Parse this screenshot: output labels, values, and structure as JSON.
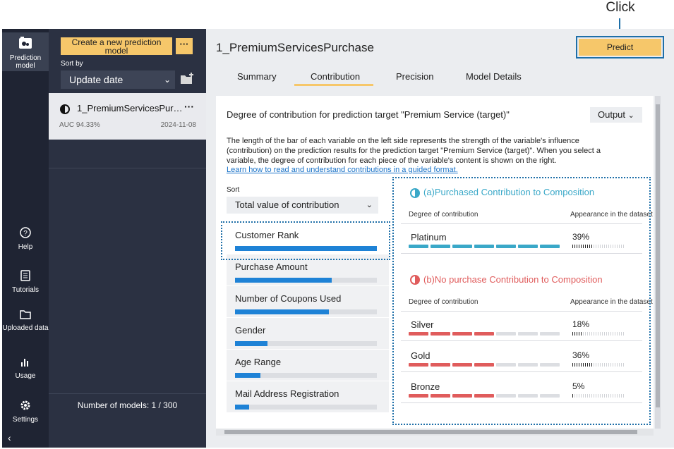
{
  "annotation": {
    "label": "Click"
  },
  "nav": {
    "items": [
      {
        "label": "Prediction model",
        "icon": "prediction-model-icon"
      },
      {
        "label": "Help",
        "icon": "help-icon"
      },
      {
        "label": "Tutorials",
        "icon": "tutorials-icon"
      },
      {
        "label": "Uploaded data",
        "icon": "folder-icon"
      },
      {
        "label": "Usage",
        "icon": "bar-chart-icon"
      },
      {
        "label": "Settings",
        "icon": "gear-icon"
      }
    ],
    "collapse": "‹"
  },
  "panel": {
    "create_label": "Create a new prediction model",
    "more_label": "···",
    "sort_by_label": "Sort by",
    "sort_value": "Update date",
    "models": [
      {
        "name": "1_PremiumServicesPurchase",
        "auc": "AUC 94.33%",
        "date": "2024-11-08"
      }
    ],
    "count_label": "Number of models: 1 / 300"
  },
  "main": {
    "title": "1_PremiumServicesPurchase",
    "predict_label": "Predict",
    "tabs": [
      "Summary",
      "Contribution",
      "Precision",
      "Model Details"
    ],
    "active_tab": "Contribution",
    "content": {
      "title": "Degree of contribution for prediction target \"Premium Service (target)\"",
      "output_label": "Output",
      "description": "The length of the bar of each variable on the left side represents the strength of the variable's influence (contribution) on the prediction results for the prediction target \"Premium Service (target)\". When you select a variable, the degree of contribution for each piece of the variable's content is shown on the right.",
      "link": "Learn how to read and understand contributions in a guided format.",
      "sort_label": "Sort",
      "sort_value": "Total value of contribution",
      "variables": [
        {
          "name": "Customer Rank",
          "value": 1.0
        },
        {
          "name": "Purchase Amount",
          "value": 0.68
        },
        {
          "name": "Number of Coupons Used",
          "value": 0.66
        },
        {
          "name": "Gender",
          "value": 0.23
        },
        {
          "name": "Age Range",
          "value": 0.18
        },
        {
          "name": "Mail Address Registration",
          "value": 0.1
        }
      ],
      "selected_variable": "Customer Rank",
      "section_a": {
        "title": "(a)Purchased Contribution to Composition",
        "color": "#3aa8c8",
        "col_contribution": "Degree of contribution",
        "col_appearance": "Appearance in the dataset",
        "rows": [
          {
            "name": "Platinum",
            "segments_on": 7,
            "percent": "39%",
            "ticks_on": 10
          }
        ]
      },
      "section_b": {
        "title": "(b)No purchase Contribution to Composition",
        "color": "#e05c5c",
        "col_contribution": "Degree of contribution",
        "col_appearance": "Appearance in the dataset",
        "rows": [
          {
            "name": "Silver",
            "segments_on": 4,
            "percent": "18%",
            "ticks_on": 5
          },
          {
            "name": "Gold",
            "segments_on": 4,
            "percent": "36%",
            "ticks_on": 10
          },
          {
            "name": "Bronze",
            "segments_on": 4,
            "percent": "5%",
            "ticks_on": 1
          }
        ]
      }
    }
  }
}
